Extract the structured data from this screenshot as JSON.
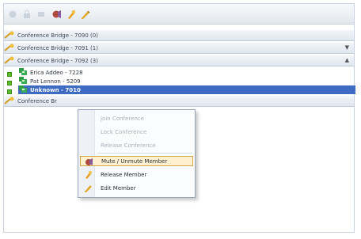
{
  "panel": {
    "bridges": [
      {
        "title": "Conference Bridge - 7090 (0)"
      },
      {
        "title": "Conference Bridge - 7091 (1)",
        "arrow": "▼"
      },
      {
        "title": "Conference Bridge - 7092 (3)",
        "arrow": "▲"
      },
      {
        "title": "Conference Br"
      }
    ],
    "members": [
      {
        "name": "Erica Addeo - 7228"
      },
      {
        "name": "Pat Lennon - 5209"
      },
      {
        "name": "Unknown - 7010"
      }
    ]
  },
  "context_menu": {
    "items": [
      {
        "label": "Join Conference",
        "disabled": true
      },
      {
        "label": "Lock Conference",
        "disabled": true
      },
      {
        "label": "Release Conference",
        "disabled": true
      },
      {
        "label": "Mute / Unmute Member",
        "icon": "mute-icon"
      },
      {
        "label": "Release Member",
        "icon": "release-icon"
      },
      {
        "label": "Edit Member",
        "icon": "edit-icon"
      }
    ]
  },
  "colors": {
    "accent": "#3d6cc2",
    "header": "#dfe6ee",
    "menu_hover": "#fdf1cf",
    "status_green": "#5ebd2f"
  }
}
